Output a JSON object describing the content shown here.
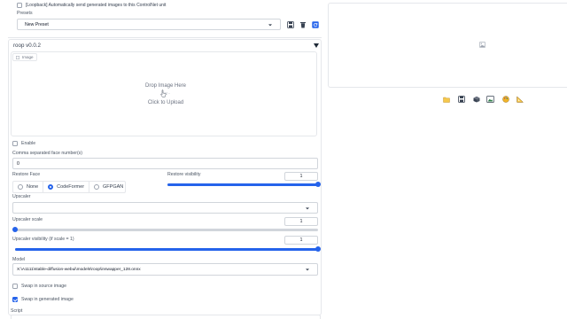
{
  "loopback": {
    "label": "[Loopback] Automatically send generated images to this ControlNet unit",
    "checked": false
  },
  "presets": {
    "label": "Presets",
    "value": "New Preset"
  },
  "roop": {
    "title": "roop v0.0.2",
    "image_tab": "Image",
    "drop_text": "Drop Image Here",
    "or_text": "- or -",
    "click_text": "Click to Upload",
    "enable_label": "Enable",
    "face_numbers_label": "Comma separated face number(s)",
    "face_numbers_value": "0",
    "restore_face_label": "Restore Face",
    "restore_options": [
      "None",
      "CodeFormer",
      "GFPGAN"
    ],
    "restore_selected": "CodeFormer",
    "restore_visibility_label": "Restore visibility",
    "restore_visibility_value": "1",
    "restore_visibility_fraction": 1.0,
    "upscaler_label": "Upscaler",
    "upscaler_value": "",
    "upscaler_scale_label": "Upscaler scale",
    "upscaler_scale_value": "1",
    "upscaler_scale_fraction": 0.0,
    "upscaler_visibility_label": "Upscaler visibility (if scale = 1)",
    "upscaler_visibility_value": "1",
    "upscaler_visibility_fraction": 1.0,
    "model_label": "Model",
    "model_value": "X:\\A1111\\stable-diffusion-webui\\models\\roop\\inswapper_128.onnx",
    "swap_source_label": "Swap in source image",
    "swap_source_checked": false,
    "swap_generated_label": "Swap in generated image",
    "swap_generated_checked": true
  },
  "script": {
    "label": "Script"
  },
  "output": {
    "image_icon": "image-placeholder-icon",
    "toolbar": [
      "folder-icon",
      "save-icon",
      "zip-icon",
      "send-to-img2img-icon",
      "send-to-inpaint-icon",
      "send-to-extras-icon"
    ]
  },
  "colors": {
    "accent": "#2563eb",
    "border": "#e5e7eb"
  }
}
